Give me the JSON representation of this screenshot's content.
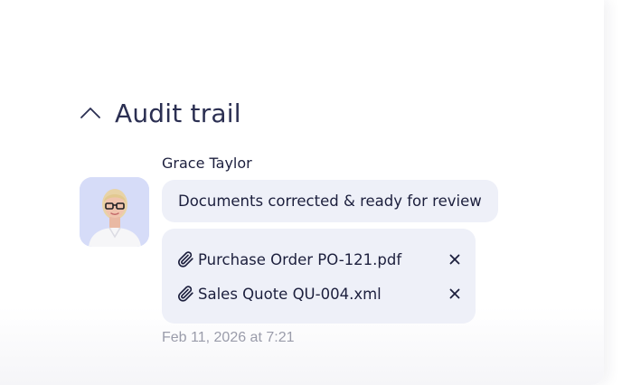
{
  "audit": {
    "title": "Audit trail",
    "toggle_icon": "chevron-up-icon"
  },
  "entry": {
    "author": "Grace Taylor",
    "avatar_icon": "user-photo",
    "message": "Documents corrected & ready for review",
    "attachments": [
      {
        "name": "Purchase Order PO-121.pdf",
        "icon": "paperclip-icon",
        "remove_icon": "close-icon"
      },
      {
        "name": "Sales Quote QU-004.xml",
        "icon": "paperclip-icon",
        "remove_icon": "close-icon"
      }
    ],
    "timestamp": "Feb 11, 2026 at 7:21"
  },
  "colors": {
    "title": "#2b2f52",
    "text": "#1c1f3d",
    "bubble": "#eef0f8",
    "avatar_bg": "#d6dcf8",
    "muted": "#9a9caa"
  }
}
